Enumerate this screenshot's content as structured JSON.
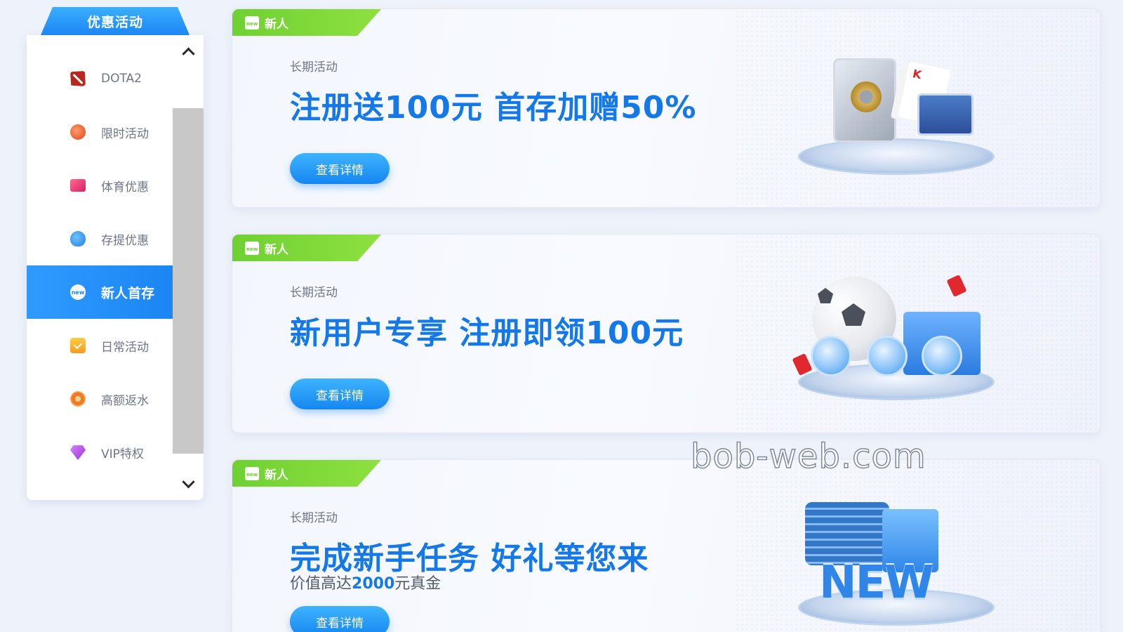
{
  "sidebar": {
    "title": "优惠活动",
    "items": [
      {
        "label": "DOTA2",
        "icon": "dota2-icon"
      },
      {
        "label": "限时活动",
        "icon": "clock-icon"
      },
      {
        "label": "体育优惠",
        "icon": "ticket-icon"
      },
      {
        "label": "存提优惠",
        "icon": "money-bag-icon"
      },
      {
        "label": "新人首存",
        "icon": "new-icon",
        "active": true
      },
      {
        "label": "日常活动",
        "icon": "calendar-check-icon"
      },
      {
        "label": "高额返水",
        "icon": "chip-icon"
      },
      {
        "label": "VIP特权",
        "icon": "vip-diamond-icon"
      }
    ]
  },
  "promos": [
    {
      "badge": "新人",
      "subtitle": "长期活动",
      "headline": "注册送100元 首存加赠50%",
      "button": "查看详情"
    },
    {
      "badge": "新人",
      "subtitle": "长期活动",
      "headline": "新用户专享 注册即领100元",
      "button": "查看详情"
    },
    {
      "badge": "新人",
      "subtitle": "长期活动",
      "headline": "完成新手任务 好礼等您来",
      "note_prefix": "价值高达",
      "note_amount": "2000",
      "note_suffix": "元真金",
      "button": "查看详情",
      "illustration_text": "NEW"
    }
  ],
  "watermark": "bob-web.com",
  "colors": {
    "accent": "#1c86f3",
    "badge_green": "#6fd132",
    "headline_blue": "#1578e8"
  }
}
